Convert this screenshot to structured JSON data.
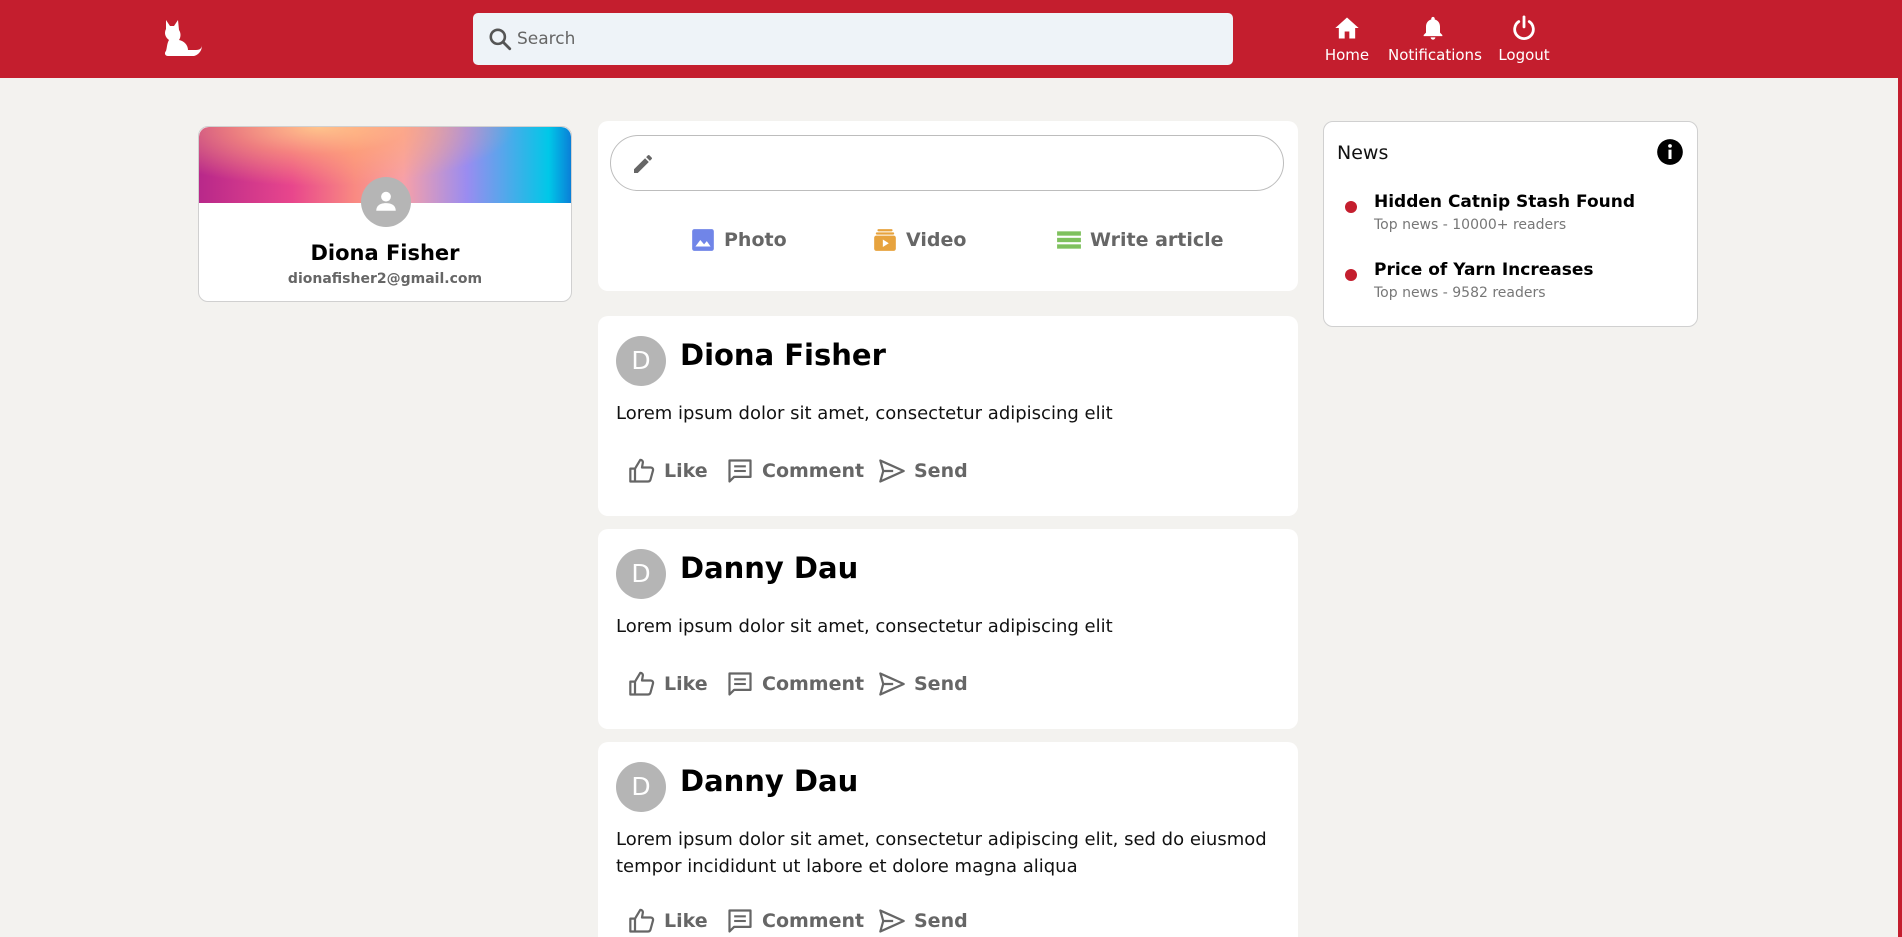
{
  "header": {
    "search_placeholder": "Search",
    "nav": [
      {
        "label": "Home",
        "icon": "home-icon"
      },
      {
        "label": "Notifications",
        "icon": "bell-icon"
      },
      {
        "label": "Logout",
        "icon": "power-icon"
      }
    ]
  },
  "colors": {
    "brand": "#c41e2e",
    "background": "#f3f2ef",
    "photo_icon": "#7085e8",
    "video_icon": "#e7a33e",
    "article_icon": "#7fc15e"
  },
  "profile": {
    "name": "Diona Fisher",
    "email": "dionafisher2@gmail.com"
  },
  "composer": {
    "actions": [
      {
        "label": "Photo",
        "icon": "photo-icon"
      },
      {
        "label": "Video",
        "icon": "video-icon"
      },
      {
        "label": "Write article",
        "icon": "article-icon"
      }
    ]
  },
  "post_actions": {
    "like": "Like",
    "comment": "Comment",
    "send": "Send"
  },
  "posts": [
    {
      "initial": "D",
      "author": "Diona Fisher",
      "text": "Lorem ipsum dolor sit amet, consectetur adipiscing elit"
    },
    {
      "initial": "D",
      "author": "Danny Dau",
      "text": "Lorem ipsum dolor sit amet, consectetur adipiscing elit"
    },
    {
      "initial": "D",
      "author": "Danny Dau",
      "text": "Lorem ipsum dolor sit amet, consectetur adipiscing elit, sed do eiusmod tempor incididunt ut labore et dolore magna aliqua"
    }
  ],
  "news": {
    "title": "News",
    "items": [
      {
        "title": "Hidden Catnip Stash Found",
        "subtitle": "Top news - 10000+ readers"
      },
      {
        "title": "Price of Yarn Increases",
        "subtitle": "Top news - 9582 readers"
      }
    ]
  }
}
